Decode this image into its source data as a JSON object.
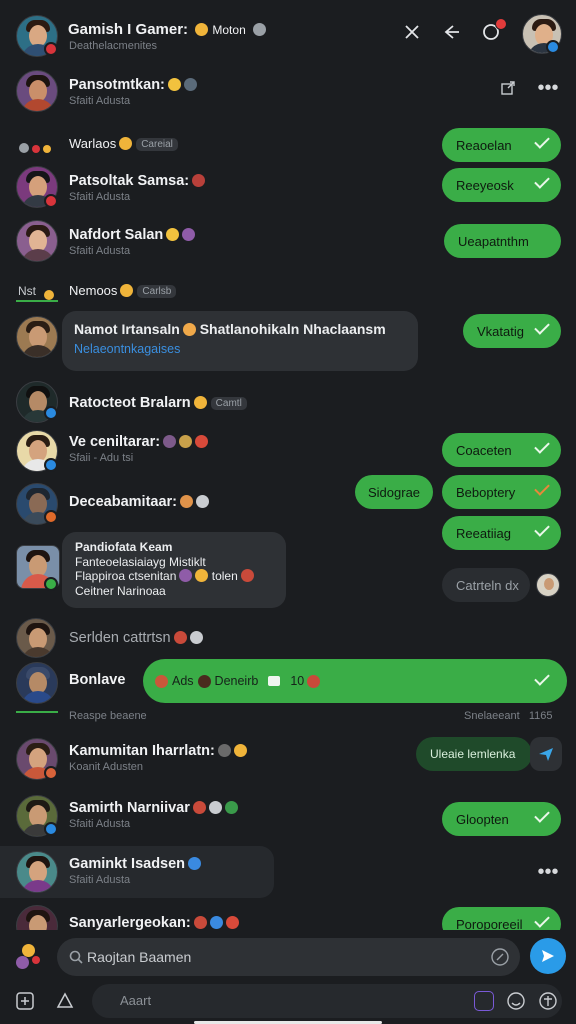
{
  "header": {
    "title": "Gamish I Gamer:",
    "title_suffix": "Moton",
    "subtitle": "Deathelacmenites"
  },
  "rows": [
    {
      "name": "Pansotmtkan:",
      "sub": "Sfaiti Adusta"
    },
    {
      "section": "Warlaos",
      "chip": "Careial"
    },
    {
      "name": "Patsoltak Samsa:",
      "sub": "Sfaiti Adusta",
      "action": "Reeyeosk"
    },
    {
      "name": "Nafdort Salan",
      "sub": "Sfaiti Adusta",
      "action": "Ueapatnthm"
    },
    {
      "section": "Nemoos",
      "chip": "Carlsb",
      "tag": "Nst"
    },
    {
      "bubble_title": "Namot Irtansaln",
      "bubble_title2": "Shatlanohikaln Nhaclaansm",
      "bubble_link": "Nelaeontnkagaises",
      "action": "Vkatatig"
    },
    {
      "name": "Ratocteot Bralarn",
      "chip": "Camtl"
    },
    {
      "name": "Ve ceniltarar:",
      "sub": "Sfaii - Adu tsi",
      "action": "Coaceten"
    },
    {
      "name": "Deceabamitaar:",
      "left_action": "Sidograe",
      "action": "Beboptery",
      "action2": "Reeatiiag"
    },
    {
      "bubble_lines": [
        "Pandiofata Keam",
        "Fanteoelasiaiayg Mistiklt",
        "Flappiroa ctsenitan",
        "Ceitner Narinoaa"
      ],
      "bubble_suffix": "tolen",
      "side": "Catrteln dx"
    },
    {
      "name": "Serlden cattrtsn"
    },
    {
      "name": "Bonlave",
      "banner_a": "Ads",
      "banner_b": "Deneirb",
      "banner_c": "10",
      "section": "Reaspe beaene",
      "section_right": "Snelaeeant",
      "section_right2": "1165"
    },
    {
      "name": "Kamumitan Iharrlatn:",
      "sub": "Koanit Adusten",
      "action": "Uleaie lemlenka"
    },
    {
      "name": "Samirth Narniivar",
      "sub": "Sfaiti Adusta",
      "action": "Gloopten"
    },
    {
      "name": "Gaminkt Isadsen",
      "sub": "Sfaiti Adusta"
    },
    {
      "name": "Sanyarlergeokan:",
      "action": "Poroporeeil"
    }
  ],
  "composer": {
    "search_placeholder": "Raojtan Baamen",
    "message_placeholder": "Aaart"
  },
  "first_action": "Reaoelan",
  "colors": {
    "accent_green": "#3aad47",
    "background": "#1b1d20",
    "send_blue": "#2a9be8"
  }
}
